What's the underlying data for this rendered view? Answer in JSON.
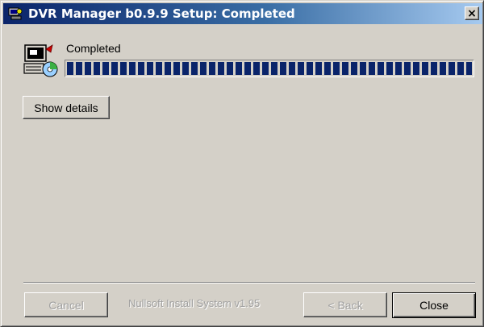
{
  "window": {
    "title": "DVR Manager b0.9.9 Setup: Completed",
    "close_glyph": "×"
  },
  "status": {
    "text": "Completed",
    "progress": 1.0
  },
  "buttons": {
    "show_details": "Show details",
    "cancel": "Cancel",
    "back": "< Back",
    "close": "Close"
  },
  "branding": {
    "text": "Nullsoft Install System v1.95"
  },
  "colors": {
    "titlebar_start": "#0a246a",
    "titlebar_end": "#a6caf0",
    "progress_fill": "#0a246a",
    "face": "#d4d0c8"
  }
}
